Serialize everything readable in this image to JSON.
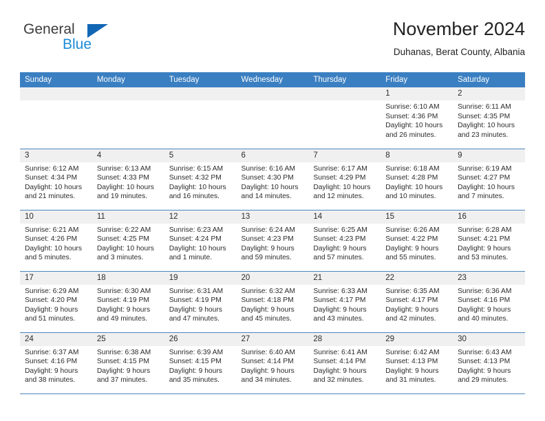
{
  "brand": {
    "name_top": "General",
    "name_bottom": "Blue",
    "accent_color": "#1267b5",
    "accent_color_light": "#1a8bd8"
  },
  "header": {
    "title": "November 2024",
    "subtitle": "Duhanas, Berat County, Albania"
  },
  "calendar": {
    "header_bg": "#3a7fc1",
    "daynum_bg": "#f0f0f0",
    "weekday_headers": [
      "Sunday",
      "Monday",
      "Tuesday",
      "Wednesday",
      "Thursday",
      "Friday",
      "Saturday"
    ],
    "weeks": [
      [
        {
          "day": "",
          "sunrise": "",
          "sunset": "",
          "daylight": ""
        },
        {
          "day": "",
          "sunrise": "",
          "sunset": "",
          "daylight": ""
        },
        {
          "day": "",
          "sunrise": "",
          "sunset": "",
          "daylight": ""
        },
        {
          "day": "",
          "sunrise": "",
          "sunset": "",
          "daylight": ""
        },
        {
          "day": "",
          "sunrise": "",
          "sunset": "",
          "daylight": ""
        },
        {
          "day": "1",
          "sunrise": "Sunrise: 6:10 AM",
          "sunset": "Sunset: 4:36 PM",
          "daylight": "Daylight: 10 hours and 26 minutes."
        },
        {
          "day": "2",
          "sunrise": "Sunrise: 6:11 AM",
          "sunset": "Sunset: 4:35 PM",
          "daylight": "Daylight: 10 hours and 23 minutes."
        }
      ],
      [
        {
          "day": "3",
          "sunrise": "Sunrise: 6:12 AM",
          "sunset": "Sunset: 4:34 PM",
          "daylight": "Daylight: 10 hours and 21 minutes."
        },
        {
          "day": "4",
          "sunrise": "Sunrise: 6:13 AM",
          "sunset": "Sunset: 4:33 PM",
          "daylight": "Daylight: 10 hours and 19 minutes."
        },
        {
          "day": "5",
          "sunrise": "Sunrise: 6:15 AM",
          "sunset": "Sunset: 4:32 PM",
          "daylight": "Daylight: 10 hours and 16 minutes."
        },
        {
          "day": "6",
          "sunrise": "Sunrise: 6:16 AM",
          "sunset": "Sunset: 4:30 PM",
          "daylight": "Daylight: 10 hours and 14 minutes."
        },
        {
          "day": "7",
          "sunrise": "Sunrise: 6:17 AM",
          "sunset": "Sunset: 4:29 PM",
          "daylight": "Daylight: 10 hours and 12 minutes."
        },
        {
          "day": "8",
          "sunrise": "Sunrise: 6:18 AM",
          "sunset": "Sunset: 4:28 PM",
          "daylight": "Daylight: 10 hours and 10 minutes."
        },
        {
          "day": "9",
          "sunrise": "Sunrise: 6:19 AM",
          "sunset": "Sunset: 4:27 PM",
          "daylight": "Daylight: 10 hours and 7 minutes."
        }
      ],
      [
        {
          "day": "10",
          "sunrise": "Sunrise: 6:21 AM",
          "sunset": "Sunset: 4:26 PM",
          "daylight": "Daylight: 10 hours and 5 minutes."
        },
        {
          "day": "11",
          "sunrise": "Sunrise: 6:22 AM",
          "sunset": "Sunset: 4:25 PM",
          "daylight": "Daylight: 10 hours and 3 minutes."
        },
        {
          "day": "12",
          "sunrise": "Sunrise: 6:23 AM",
          "sunset": "Sunset: 4:24 PM",
          "daylight": "Daylight: 10 hours and 1 minute."
        },
        {
          "day": "13",
          "sunrise": "Sunrise: 6:24 AM",
          "sunset": "Sunset: 4:23 PM",
          "daylight": "Daylight: 9 hours and 59 minutes."
        },
        {
          "day": "14",
          "sunrise": "Sunrise: 6:25 AM",
          "sunset": "Sunset: 4:23 PM",
          "daylight": "Daylight: 9 hours and 57 minutes."
        },
        {
          "day": "15",
          "sunrise": "Sunrise: 6:26 AM",
          "sunset": "Sunset: 4:22 PM",
          "daylight": "Daylight: 9 hours and 55 minutes."
        },
        {
          "day": "16",
          "sunrise": "Sunrise: 6:28 AM",
          "sunset": "Sunset: 4:21 PM",
          "daylight": "Daylight: 9 hours and 53 minutes."
        }
      ],
      [
        {
          "day": "17",
          "sunrise": "Sunrise: 6:29 AM",
          "sunset": "Sunset: 4:20 PM",
          "daylight": "Daylight: 9 hours and 51 minutes."
        },
        {
          "day": "18",
          "sunrise": "Sunrise: 6:30 AM",
          "sunset": "Sunset: 4:19 PM",
          "daylight": "Daylight: 9 hours and 49 minutes."
        },
        {
          "day": "19",
          "sunrise": "Sunrise: 6:31 AM",
          "sunset": "Sunset: 4:19 PM",
          "daylight": "Daylight: 9 hours and 47 minutes."
        },
        {
          "day": "20",
          "sunrise": "Sunrise: 6:32 AM",
          "sunset": "Sunset: 4:18 PM",
          "daylight": "Daylight: 9 hours and 45 minutes."
        },
        {
          "day": "21",
          "sunrise": "Sunrise: 6:33 AM",
          "sunset": "Sunset: 4:17 PM",
          "daylight": "Daylight: 9 hours and 43 minutes."
        },
        {
          "day": "22",
          "sunrise": "Sunrise: 6:35 AM",
          "sunset": "Sunset: 4:17 PM",
          "daylight": "Daylight: 9 hours and 42 minutes."
        },
        {
          "day": "23",
          "sunrise": "Sunrise: 6:36 AM",
          "sunset": "Sunset: 4:16 PM",
          "daylight": "Daylight: 9 hours and 40 minutes."
        }
      ],
      [
        {
          "day": "24",
          "sunrise": "Sunrise: 6:37 AM",
          "sunset": "Sunset: 4:16 PM",
          "daylight": "Daylight: 9 hours and 38 minutes."
        },
        {
          "day": "25",
          "sunrise": "Sunrise: 6:38 AM",
          "sunset": "Sunset: 4:15 PM",
          "daylight": "Daylight: 9 hours and 37 minutes."
        },
        {
          "day": "26",
          "sunrise": "Sunrise: 6:39 AM",
          "sunset": "Sunset: 4:15 PM",
          "daylight": "Daylight: 9 hours and 35 minutes."
        },
        {
          "day": "27",
          "sunrise": "Sunrise: 6:40 AM",
          "sunset": "Sunset: 4:14 PM",
          "daylight": "Daylight: 9 hours and 34 minutes."
        },
        {
          "day": "28",
          "sunrise": "Sunrise: 6:41 AM",
          "sunset": "Sunset: 4:14 PM",
          "daylight": "Daylight: 9 hours and 32 minutes."
        },
        {
          "day": "29",
          "sunrise": "Sunrise: 6:42 AM",
          "sunset": "Sunset: 4:13 PM",
          "daylight": "Daylight: 9 hours and 31 minutes."
        },
        {
          "day": "30",
          "sunrise": "Sunrise: 6:43 AM",
          "sunset": "Sunset: 4:13 PM",
          "daylight": "Daylight: 9 hours and 29 minutes."
        }
      ]
    ]
  }
}
